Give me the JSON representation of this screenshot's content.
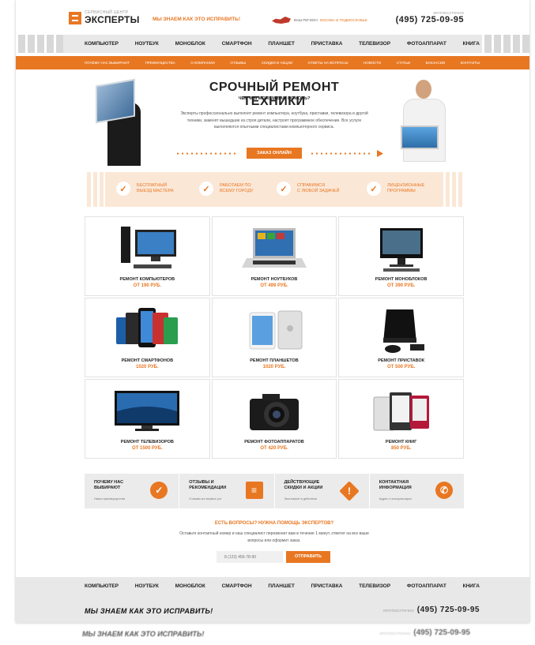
{
  "header": {
    "logo_small": "Сервисный центр",
    "logo_big": "ЭКСПЕРТЫ",
    "slogan": "МЫ ЗНАЕМ КАК ЭТО ИСПРАВИТЬ!",
    "region_label": "ВАШ РЕГИОН:",
    "region_value": "МОСКВА И ПОДМОСКОВЬЕ",
    "phone_caption": "КРУГЛОСУТОЧНО",
    "phone": "(495) 725-09-95"
  },
  "nav": [
    "КОМПЬЮТЕР",
    "НОУТБУК",
    "МОНОБЛОК",
    "СМАРТФОН",
    "ПЛАНШЕТ",
    "ПРИСТАВКА",
    "ТЕЛЕВИЗОР",
    "ФОТОАППАРАТ",
    "КНИГА"
  ],
  "subnav": [
    "ПОЧЕМУ НАС ВЫБИРАЮТ",
    "ПРЕИМУЩЕСТВА",
    "О КОМПАНИИ",
    "ОТЗЫВЫ",
    "СКИДКИ И АКЦИИ",
    "ОТВЕТЫ НА ВОПРОСЫ",
    "НОВОСТИ",
    "СТАТЬИ",
    "ВАКАНСИИ",
    "КОНТАКТЫ"
  ],
  "hero": {
    "title": "СРОЧНЫЙ РЕМОНТ ТЕХНИКИ",
    "subtitle": "ЧЕМ МЫ МОЖЕМ ВАМ ПОМОЧЬ?",
    "text": "Эксперты профессионально выполнят ремонт компьютера, ноутбука, приставки, телевизора и другой техники, заменят вышедшие из строя детали, настроят программное обеспечение. Все услуги выполняются опытными специалистами компьютерного сервиса.",
    "button": "ЗАКАЗ ОНЛАЙН"
  },
  "features": [
    {
      "line1": "БЕСПЛАТНЫЙ",
      "line2": "ВЫЕЗД МАСТЕРА"
    },
    {
      "line1": "РАБОТАЕМ ПО",
      "line2": "ВСЕМУ ГОРОДУ"
    },
    {
      "line1": "СПРАВИМСЯ",
      "line2": "С ЛЮБОЙ ЗАДАЧЕЙ"
    },
    {
      "line1": "ЛИЦЕНЗИОННЫЕ",
      "line2": "ПРОГРАММЫ"
    }
  ],
  "services": [
    {
      "name": "РЕМОНТ КОМПЬЮТЕРОВ",
      "price": "ОТ 190 РУБ.",
      "icon": "desktop-computer-icon"
    },
    {
      "name": "РЕМОНТ НОУТБУКОВ",
      "price": "ОТ 499 РУБ.",
      "icon": "laptop-icon"
    },
    {
      "name": "РЕМОНТ МОНОБЛОКОВ",
      "price": "ОТ 390 РУБ.",
      "icon": "all-in-one-icon"
    },
    {
      "name": "РЕМОНТ СМАРТФОНОВ",
      "price": "1020 РУБ.",
      "icon": "smartphone-icon"
    },
    {
      "name": "РЕМОНТ ПЛАНШЕТОВ",
      "price": "1020 РУБ.",
      "icon": "tablet-icon"
    },
    {
      "name": "РЕМОНТ ПРИСТАВОК",
      "price": "ОТ 500 РУБ.",
      "icon": "console-icon"
    },
    {
      "name": "РЕМОНТ ТЕЛЕВИЗОРОВ",
      "price": "ОТ 1500 РУБ.",
      "icon": "tv-icon"
    },
    {
      "name": "РЕМОНТ ФОТОАППАРАТОВ",
      "price": "ОТ 420 РУБ.",
      "icon": "camera-icon"
    },
    {
      "name": "РЕМОНТ КНИГ",
      "price": "850 РУБ.",
      "icon": "ebook-icon"
    }
  ],
  "info": [
    {
      "title": "ПОЧЕМУ НАС ВЫБИРАЮТ",
      "sub": "Наши преимущества",
      "icon": "check-icon"
    },
    {
      "title": "ОТЗЫВЫ И РЕКОМЕНДАЦИИ",
      "sub": "Отзывы из первых уст",
      "icon": "comment-icon"
    },
    {
      "title": "ДЕЙСТВУЮЩИЕ СКИДКИ И АКЦИИ",
      "sub": "Экономьте в действии",
      "icon": "alert-icon"
    },
    {
      "title": "КОНТАКТНАЯ ИНФОРМАЦИЯ",
      "sub": "Адрес и консультации",
      "icon": "phone-icon"
    }
  ],
  "question": {
    "title": "ЕСТЬ ВОПРОСЫ? НУЖНА ПОМОЩЬ ЭКСПЕРТОВ?",
    "text": "Оставьте контактный номер и наш специалист перезвонит вам в течение 1 минут, ответит на все ваши вопросы или оформит заказ.",
    "placeholder": "8 (123) 456-78-90",
    "button": "ОТПРАВИТЬ"
  },
  "footer": {
    "slogan": "МЫ ЗНАЕМ КАК ЭТО ИСПРАВИТЬ!",
    "phone_caption": "КРУГЛОСУТОЧНО",
    "phone": "(495) 725-09-95"
  },
  "colors": {
    "accent": "#e87722",
    "nav_bg": "#e8e8e8",
    "feature_bg": "#fbe7d6"
  }
}
